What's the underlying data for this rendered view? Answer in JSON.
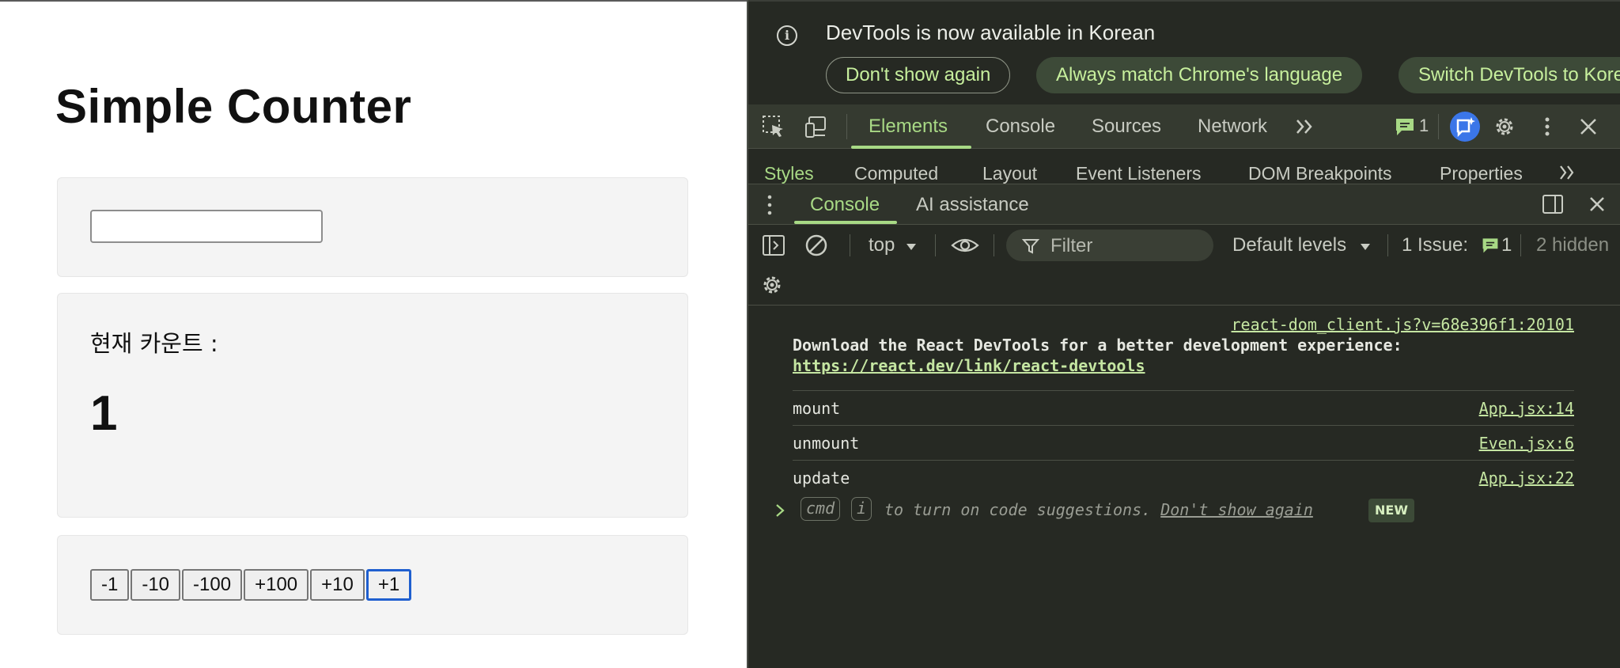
{
  "app": {
    "title": "Simple Counter",
    "input_value": "",
    "count_label": "현재 카운트 :",
    "count_value": "1",
    "buttons": [
      "-1",
      "-10",
      "-100",
      "+100",
      "+10",
      "+1"
    ],
    "focused_button": "+1"
  },
  "devtools": {
    "infobar": {
      "message": "DevTools is now available in Korean",
      "buttons": [
        "Don't show again",
        "Always match Chrome's language",
        "Switch DevTools to Korean"
      ]
    },
    "main_tabs": [
      "Elements",
      "Console",
      "Sources",
      "Network"
    ],
    "active_main_tab": "Elements",
    "issues_count": "1",
    "styles_tabs": [
      "Styles",
      "Computed",
      "Layout",
      "Event Listeners",
      "DOM Breakpoints",
      "Properties"
    ],
    "drawer_tabs": [
      "Console",
      "AI assistance"
    ],
    "active_drawer_tab": "Console",
    "console_toolbar": {
      "context": "top",
      "filter_placeholder": "Filter",
      "levels": "Default levels",
      "issues_label": "1 Issue:",
      "issues_count": "1",
      "hidden": "2 hidden"
    },
    "messages": [
      {
        "source": "react-dom_client.js?v=68e396f1:20101",
        "text": "Download the React DevTools for a better development experience:",
        "link": "https://react.dev/link/react-devtools"
      },
      {
        "text": "mount",
        "source": "App.jsx:14"
      },
      {
        "text": "unmount",
        "source": "Even.jsx:6"
      },
      {
        "text": "update",
        "source": "App.jsx:22"
      }
    ],
    "prompt_hint": {
      "key1": "cmd",
      "key2": "i",
      "text": "to turn on code suggestions.",
      "link": "Don't show again",
      "badge": "NEW"
    },
    "colors": {
      "background": "#262923",
      "toolbar": "#353a30",
      "accent": "#a8d985",
      "link": "#c5e6a2"
    }
  }
}
